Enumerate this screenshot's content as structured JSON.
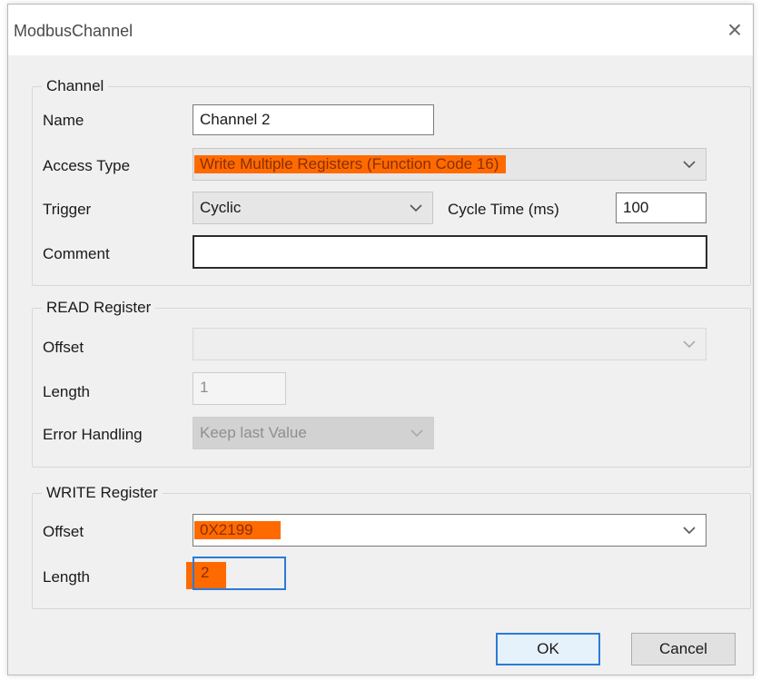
{
  "window": {
    "title": "ModbusChannel"
  },
  "channel": {
    "group_title": "Channel",
    "name_label": "Name",
    "name_value": "Channel 2",
    "access_type_label": "Access Type",
    "access_type_value": "Write Multiple Registers (Function Code 16)",
    "trigger_label": "Trigger",
    "trigger_value": "Cyclic",
    "cycle_time_label": "Cycle Time (ms)",
    "cycle_time_value": "100",
    "comment_label": "Comment",
    "comment_value": ""
  },
  "read_register": {
    "group_title": "READ Register",
    "offset_label": "Offset",
    "offset_value": "",
    "length_label": "Length",
    "length_value": "1",
    "error_handling_label": "Error Handling",
    "error_handling_value": "Keep last Value"
  },
  "write_register": {
    "group_title": "WRITE Register",
    "offset_label": "Offset",
    "offset_value": "0X2199",
    "length_label": "Length",
    "length_value": "2"
  },
  "buttons": {
    "ok": "OK",
    "cancel": "Cancel"
  },
  "colors": {
    "highlight": "#ff6a00",
    "focus_border": "#2b7bd6",
    "dialog_bg": "#f0f0f0"
  }
}
